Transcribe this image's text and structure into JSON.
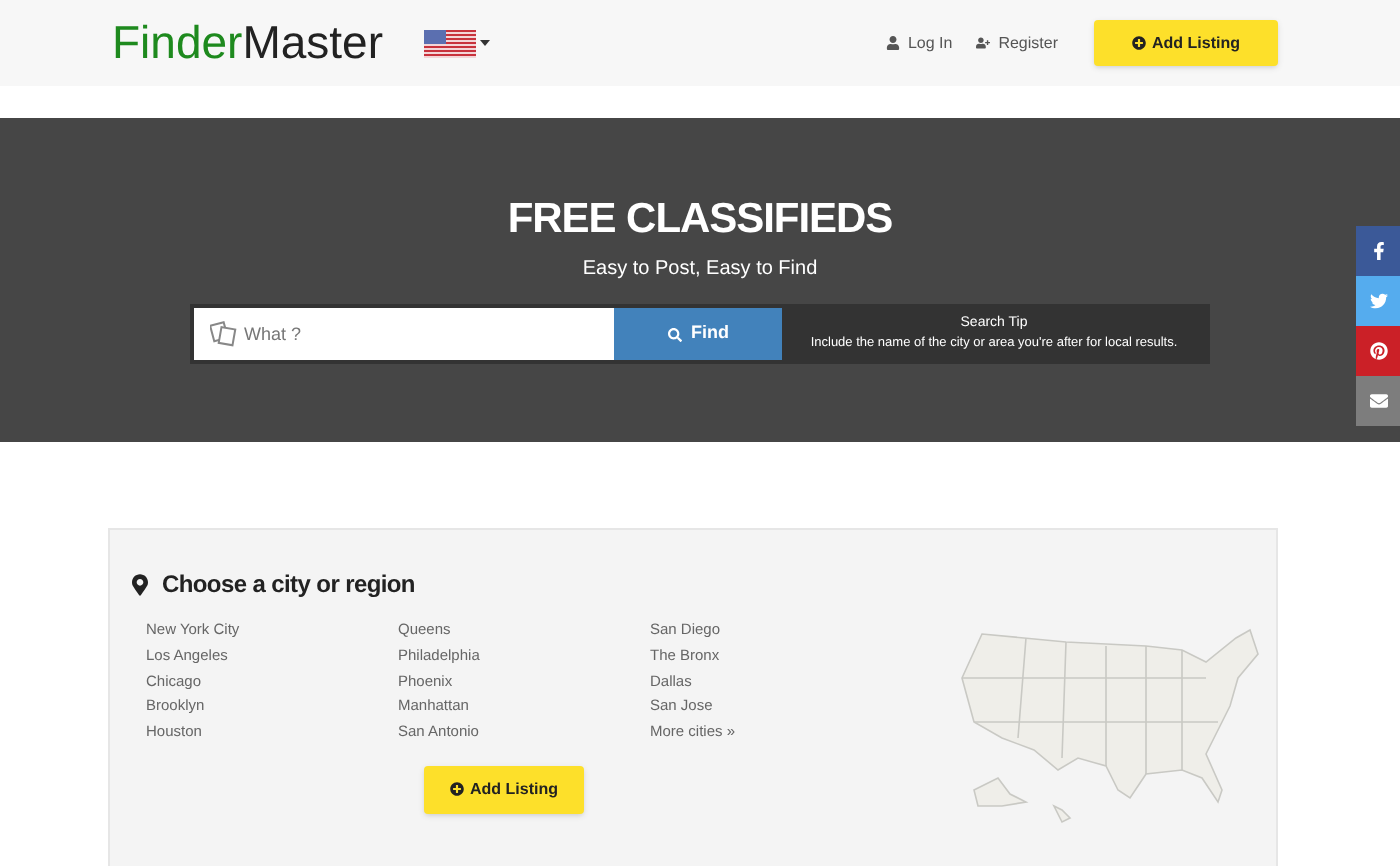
{
  "header": {
    "logo": {
      "part_1": "Finder",
      "part_2": "Master"
    },
    "nav": [
      {
        "kind": "login",
        "label": "Log In"
      },
      {
        "kind": "register",
        "label": "Register"
      }
    ],
    "add_button": "Add Listing"
  },
  "hero": {
    "title": "FREE CLASSIFIEDS",
    "subtitle": "Easy to Post, Easy to Find",
    "search": {
      "placeholder": "What ?"
    },
    "find_button": "Find",
    "tip": {
      "title": "Search Tip",
      "text": "Include the name of the city or area you're after for local results."
    }
  },
  "social": [
    {
      "kind": "facebook",
      "color": "#3b5998"
    },
    {
      "kind": "twitter",
      "color": "#55acee"
    },
    {
      "kind": "pinterest",
      "color": "#cb2027"
    },
    {
      "kind": "email",
      "color": "#7d7d7d"
    }
  ],
  "cities": {
    "title": "Choose a city or region",
    "columns": [
      [
        "New York City",
        "Los Angeles",
        "Chicago",
        "Brooklyn",
        "Houston"
      ],
      [
        "Queens",
        "Philadelphia",
        "Phoenix",
        "Manhattan",
        "San Antonio"
      ],
      [
        "San Diego",
        "The Bronx",
        "Dallas",
        "San Jose",
        "More cities »"
      ]
    ],
    "add_button": "Add Listing"
  }
}
